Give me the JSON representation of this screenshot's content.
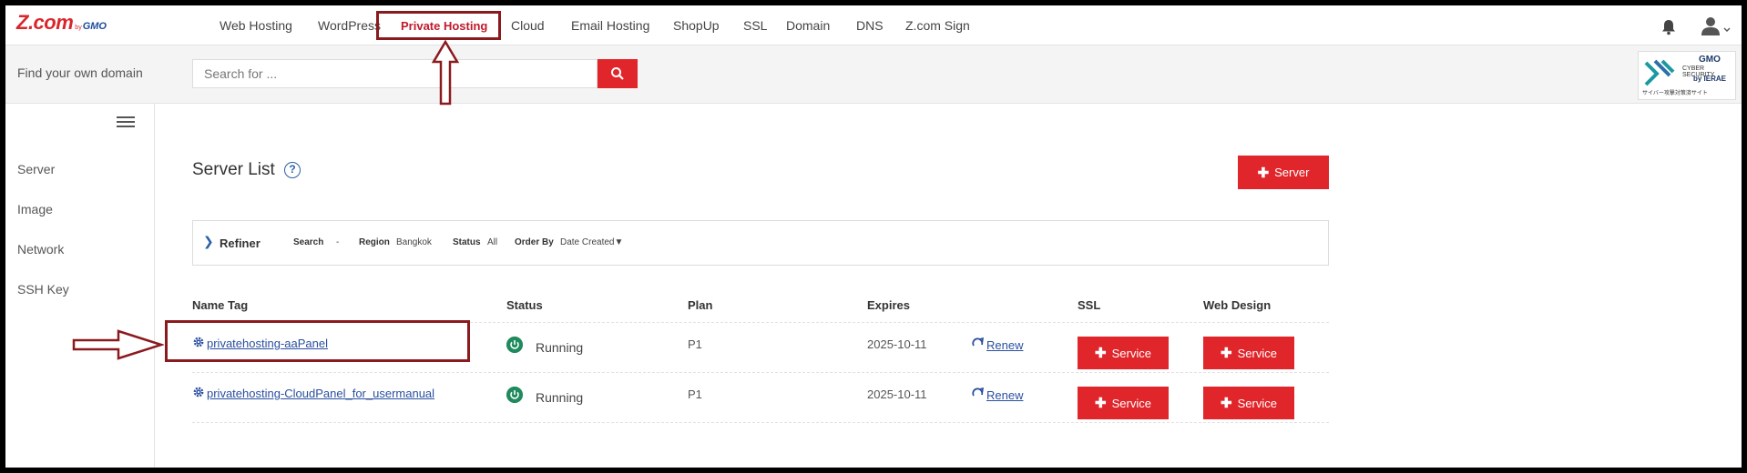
{
  "brand": {
    "logo_main": "Z.com",
    "logo_by": "by",
    "logo_gmo": "GMO"
  },
  "nav": {
    "items": [
      {
        "label": "Web Hosting"
      },
      {
        "label": "WordPress"
      },
      {
        "label": "Private Hosting",
        "active": true
      },
      {
        "label": "Cloud"
      },
      {
        "label": "Email Hosting"
      },
      {
        "label": "ShopUp"
      },
      {
        "label": "SSL"
      },
      {
        "label": "Domain"
      },
      {
        "label": "DNS"
      },
      {
        "label": "Z.com Sign"
      }
    ]
  },
  "domain_search": {
    "label": "Find your own domain",
    "placeholder": "Search for ..."
  },
  "badge": {
    "line1": "GMO",
    "line2": "CYBER SECURITY",
    "line3": "by IERAE",
    "line4": "サイバー攻撃対策済サイト"
  },
  "sidebar": {
    "items": [
      {
        "label": "Server"
      },
      {
        "label": "Image"
      },
      {
        "label": "Network"
      },
      {
        "label": "SSH Key"
      }
    ]
  },
  "main": {
    "title": "Server List",
    "help": "?",
    "add_server_label": "Server",
    "refiner": {
      "label": "Refiner",
      "search_key": "Search",
      "search_value": "-",
      "region_key": "Region",
      "region_value": "Bangkok",
      "status_key": "Status",
      "status_value": "All",
      "order_key": "Order By",
      "order_value": "Date Created▼"
    },
    "table": {
      "headers": {
        "name": "Name Tag",
        "status": "Status",
        "plan": "Plan",
        "expires": "Expires",
        "ssl": "SSL",
        "web_design": "Web Design"
      },
      "rows": [
        {
          "name": "privatehosting-aaPanel",
          "status": "Running",
          "plan": "P1",
          "expires": "2025-10-11",
          "renew": "Renew",
          "ssl_btn": "Service",
          "web_btn": "Service"
        },
        {
          "name": "privatehosting-CloudPanel_for_usermanual",
          "status": "Running",
          "plan": "P1",
          "expires": "2025-10-11",
          "renew": "Renew",
          "ssl_btn": "Service",
          "web_btn": "Service"
        }
      ]
    }
  },
  "colors": {
    "accent": "#e0262b",
    "link": "#2a4fa0",
    "annotation": "#8b1a1f",
    "running": "#1f8a5e"
  }
}
